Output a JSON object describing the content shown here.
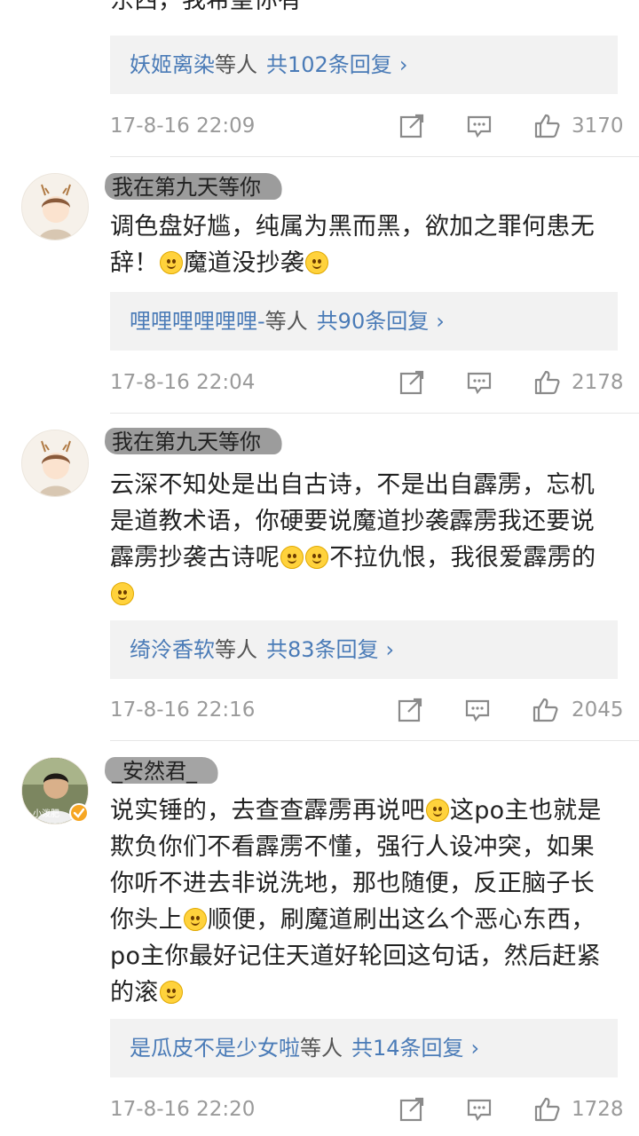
{
  "comments": [
    {
      "text": "东西，我希望你有",
      "reply": {
        "names": "妖姬离染",
        "suffix": "等人",
        "count": "共102条回复",
        "chev": "›"
      },
      "time": "17-8-16 22:09",
      "likes": "3170"
    },
    {
      "username": "我在第九天等你",
      "text_parts": [
        "调色盘好尴，纯属为黑而黑，欲加之罪何患无辞！",
        "魔道没抄袭",
        ""
      ],
      "reply": {
        "names": "哩哩哩哩哩哩-",
        "suffix": "等人",
        "count": "共90条回复",
        "chev": "›"
      },
      "time": "17-8-16 22:04",
      "likes": "2178"
    },
    {
      "username": "我在第九天等你",
      "text_parts": [
        "云深不知处是出自古诗，不是出自霹雳，忘机是道教术语，你硬要说魔道抄袭霹雳我还要说霹雳抄袭古诗呢",
        "不拉仇恨，我很爱霹雳的",
        ""
      ],
      "reply": {
        "names": "绮泠香软",
        "suffix": "等人",
        "count": "共83条回复",
        "chev": "›"
      },
      "time": "17-8-16 22:16",
      "likes": "2045"
    },
    {
      "username": "_安然君_",
      "avatar_caption": "小泼肥",
      "text_parts": [
        "说实锤的，去查查霹雳再说吧",
        "这po主也就是欺负你们不看霹雳不懂，强行人设冲突，如果你听不进去非说洗地，那也随便，反正脑子长你头上",
        "顺便，刷魔道刷出这么个恶心东西，po主你最好记住天道好轮回这句话，然后赶紧的滚",
        ""
      ],
      "reply": {
        "names": "是瓜皮不是少女啦",
        "suffix": "等人",
        "count": "共14条回复",
        "chev": "›"
      },
      "time": "17-8-16 22:20",
      "likes": "1728"
    }
  ],
  "icons": [
    "share-icon",
    "comment-icon",
    "like-icon",
    "emoji-icon",
    "verified-icon"
  ],
  "colors": {
    "link": "#4a7bb7",
    "meta": "#9a9a9a",
    "reply_bg": "#f2f2f2",
    "badge": "#f6a623"
  }
}
